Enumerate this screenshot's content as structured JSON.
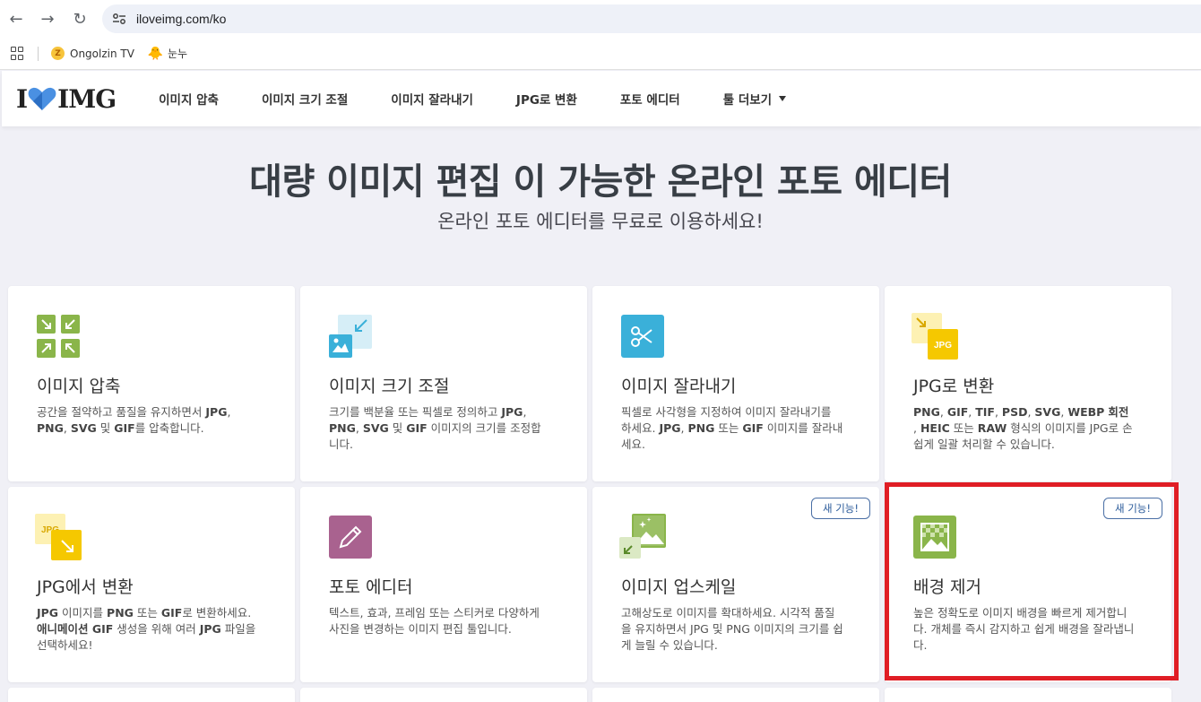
{
  "browser": {
    "url": "iloveimg.com/ko",
    "bookmarks": [
      {
        "label": "Ongolzin TV"
      },
      {
        "label": "눈누"
      }
    ]
  },
  "header": {
    "logo_left": "I",
    "logo_right": "IMG",
    "menu": [
      {
        "label": "이미지 압축"
      },
      {
        "label": "이미지 크기 조절"
      },
      {
        "label": "이미지 잘라내기"
      },
      {
        "label": "JPG로 변환"
      },
      {
        "label": "포토 에디터"
      },
      {
        "label": "툴 더보기"
      }
    ]
  },
  "hero": {
    "title": "대량 이미지 편집 이 가능한 온라인 포토 에디터",
    "subtitle": "온라인 포토 에디터를 무료로 이용하세요!"
  },
  "tools": [
    {
      "title": "이미지 압축",
      "desc_html": "공간을 절약하고 품질을 유지하면서 <b>JPG</b>, <b>PNG</b>, <b>SVG</b> 및 <b>GIF</b>를 압축합니다.",
      "icon": "compress-icon",
      "color": "#8ab54a"
    },
    {
      "title": "이미지 크기 조절",
      "desc_html": "크기를 백분율 또는 픽셀로 정의하고 <b>JPG</b>, <b>PNG</b>, <b>SVG</b> 및 <b>GIF</b> 이미지의 크기를 조정합니다.",
      "icon": "resize-icon",
      "color": "#3ab0d9"
    },
    {
      "title": "이미지 잘라내기",
      "desc_html": "픽셀로 사각형을 지정하여 이미지 잘라내기를 하세요. <b>JPG</b>, <b>PNG</b> 또는 <b>GIF</b> 이미지를 잘라내세요.",
      "icon": "scissors-icon",
      "color": "#3ab0d9"
    },
    {
      "title": "JPG로 변환",
      "desc_html": "<b>PNG</b>, <b>GIF</b>, <b>TIF</b>, <b>PSD</b>, <b>SVG</b>, <b>WEBP</b> <b>회전</b> , <b>HEIC</b> 또는 <b>RAW</b> 형식의 이미지를 JPG로 손쉽게 일괄 처리할 수 있습니다.",
      "icon": "to-jpg-icon",
      "color": "#f5c800"
    },
    {
      "title": "JPG에서 변환",
      "desc_html": "<b>JPG</b> 이미지를 <b>PNG</b> 또는 <b>GIF</b>로 변환하세요. <b>애니메이션 GIF</b> 생성을 위해 여러 <b>JPG</b> 파일을 선택하세요!",
      "icon": "from-jpg-icon",
      "color": "#f5c800"
    },
    {
      "title": "포토 에디터",
      "desc_html": "텍스트, 효과, 프레임 또는 스티커로 다양하게 사진을 변경하는 이미지 편집 툴입니다.",
      "icon": "pencil-icon",
      "color": "#a9628f"
    },
    {
      "title": "이미지 업스케일",
      "desc_html": "고해상도로 이미지를 확대하세요. 시각적 품질을 유지하면서 JPG 및 PNG 이미지의 크기를 쉽게 늘릴 수 있습니다.",
      "icon": "upscale-icon",
      "color": "#8ab54a",
      "badge": "새 기능!"
    },
    {
      "title": "배경 제거",
      "desc_html": "높은 정확도로 이미지 배경을 빠르게 제거합니다. 개체를 즉시 감지하고 쉽게 배경을 잘라냅니다.",
      "icon": "remove-background-icon",
      "color": "#8ab54a",
      "badge": "새 기능!"
    }
  ]
}
